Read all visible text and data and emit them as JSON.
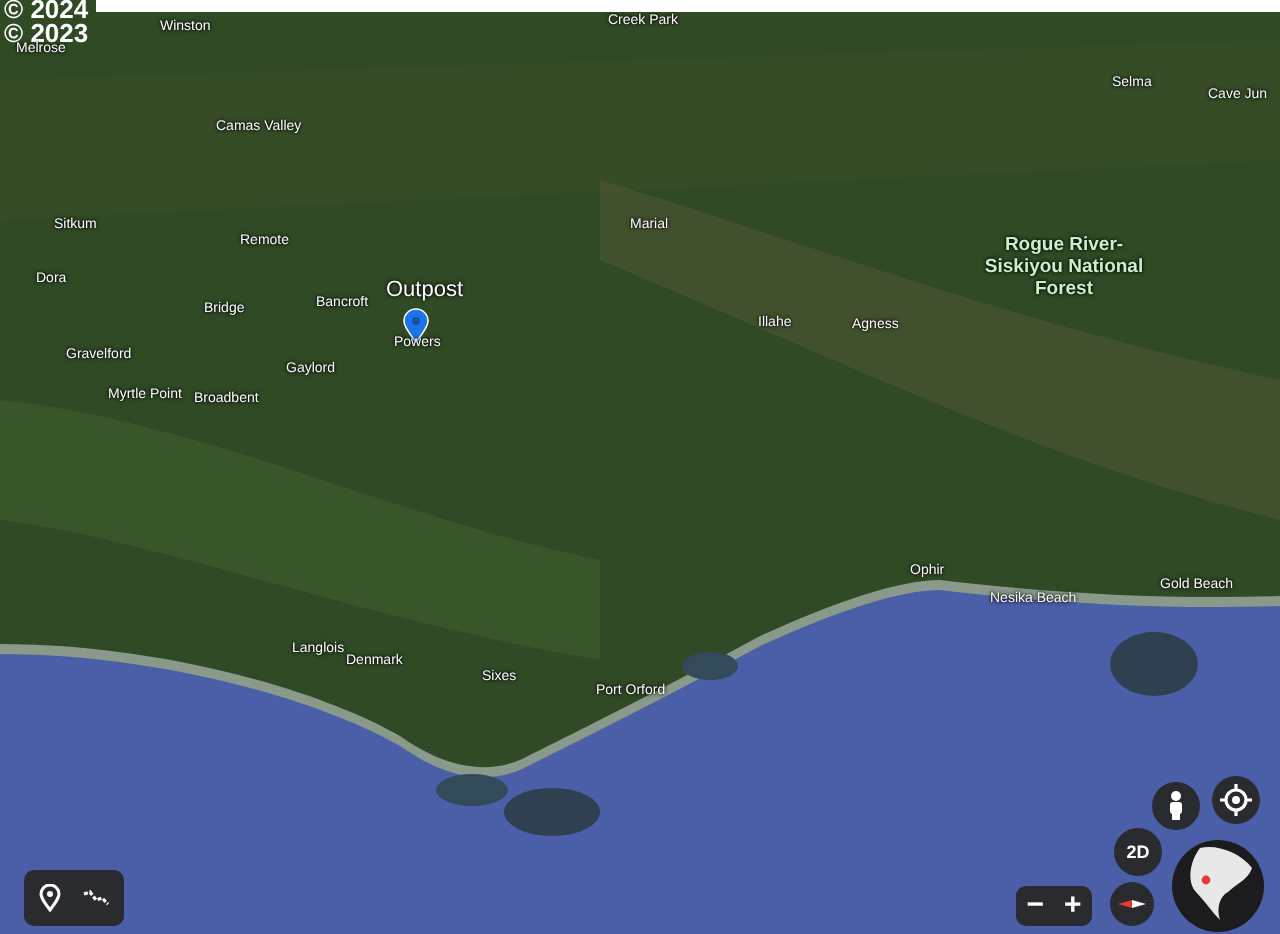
{
  "attribution": [
    "© 2024",
    "© 2023"
  ],
  "places": [
    {
      "kind": "town",
      "name": "Winston"
    },
    {
      "kind": "town",
      "name": "Melrose"
    },
    {
      "kind": "town",
      "name": "Creek Park"
    },
    {
      "kind": "town",
      "name": "Camas Valley"
    },
    {
      "kind": "town",
      "name": "Sitkum"
    },
    {
      "kind": "town",
      "name": "Remote"
    },
    {
      "kind": "town",
      "name": "Dora"
    },
    {
      "kind": "town",
      "name": "Bridge"
    },
    {
      "kind": "town",
      "name": "Bancroft"
    },
    {
      "kind": "pin",
      "name": "Outpost"
    },
    {
      "kind": "town",
      "name": "Powers"
    },
    {
      "kind": "town",
      "name": "Gravelford"
    },
    {
      "kind": "town",
      "name": "Gaylord"
    },
    {
      "kind": "town",
      "name": "Myrtle Point"
    },
    {
      "kind": "town",
      "name": "Broadbent"
    },
    {
      "kind": "town",
      "name": "Marial"
    },
    {
      "kind": "town",
      "name": "Illahe"
    },
    {
      "kind": "town",
      "name": "Agness"
    },
    {
      "kind": "town",
      "name": "Selma"
    },
    {
      "kind": "town",
      "name": "Cave Jun"
    },
    {
      "kind": "forest",
      "name": "Rogue River-Siskiyou National Forest"
    },
    {
      "kind": "town",
      "name": "Ophir"
    },
    {
      "kind": "town",
      "name": "Nesika Beach"
    },
    {
      "kind": "town",
      "name": "Gold Beach"
    },
    {
      "kind": "town",
      "name": "Langlois"
    },
    {
      "kind": "town",
      "name": "Denmark"
    },
    {
      "kind": "town",
      "name": "Sixes"
    },
    {
      "kind": "town",
      "name": "Port Orford"
    }
  ],
  "view_mode": "2D",
  "zoom_controls": [
    "−",
    "+"
  ]
}
